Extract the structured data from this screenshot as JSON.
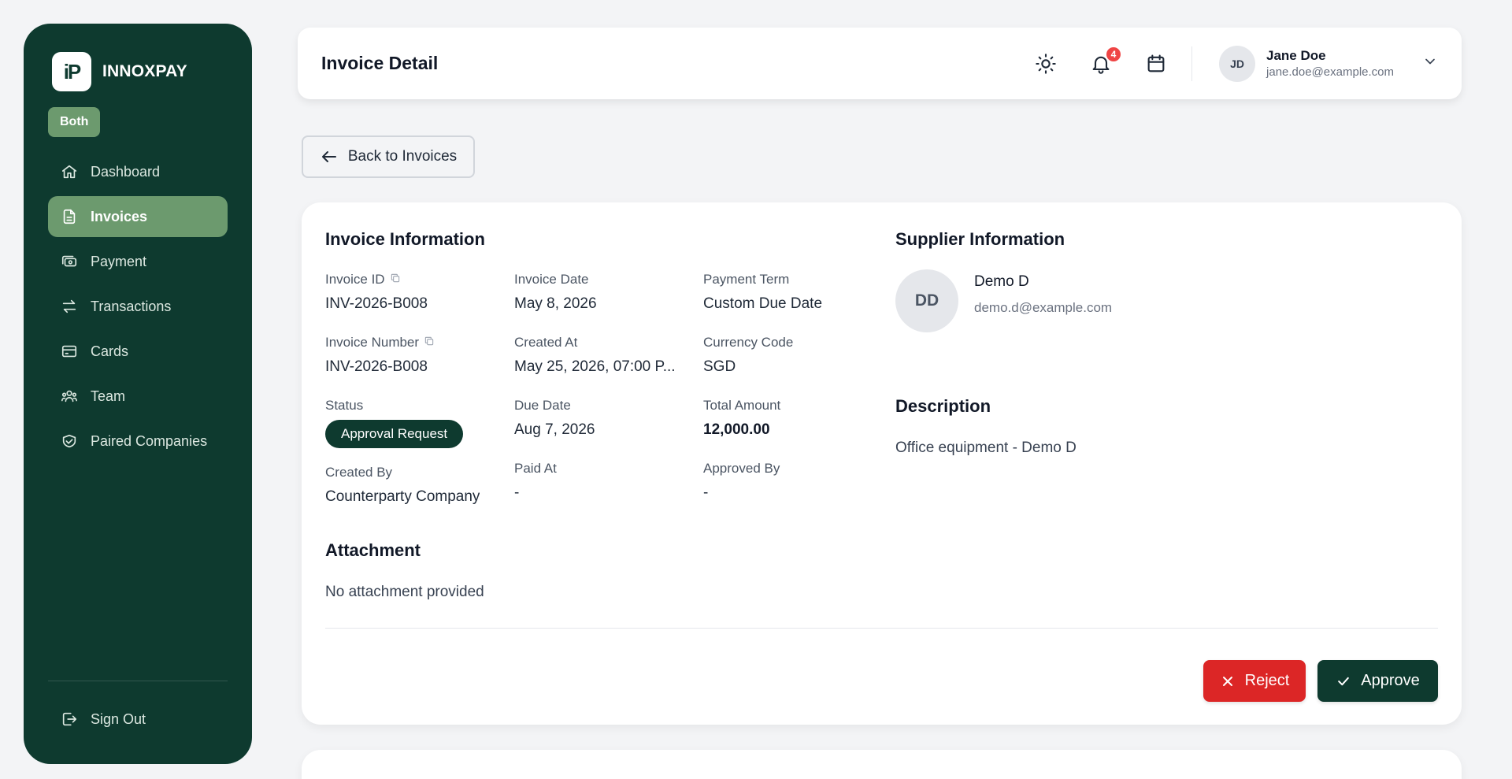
{
  "brand": {
    "logo_text": "iP",
    "name": "INNOXPAY",
    "mode": "Both"
  },
  "sidebar": {
    "items": [
      {
        "label": "Dashboard",
        "icon": "home-icon"
      },
      {
        "label": "Invoices",
        "icon": "file-text-icon",
        "active": true
      },
      {
        "label": "Payment",
        "icon": "cash-icon"
      },
      {
        "label": "Transactions",
        "icon": "arrows-exchange-icon"
      },
      {
        "label": "Cards",
        "icon": "credit-card-icon"
      },
      {
        "label": "Team",
        "icon": "users-icon"
      },
      {
        "label": "Paired Companies",
        "icon": "handshake-icon"
      }
    ],
    "sign_out": "Sign Out"
  },
  "header": {
    "title": "Invoice Detail",
    "notification_count": "4",
    "user": {
      "initials": "JD",
      "name": "Jane Doe",
      "email": "jane.doe@example.com"
    }
  },
  "back_button": "Back to Invoices",
  "invoice": {
    "section_title": "Invoice Information",
    "fields": {
      "invoice_id": {
        "label": "Invoice ID",
        "value": "INV-2026-B008"
      },
      "invoice_date": {
        "label": "Invoice Date",
        "value": "May 8, 2026"
      },
      "payment_term": {
        "label": "Payment Term",
        "value": "Custom Due Date"
      },
      "invoice_number": {
        "label": "Invoice Number",
        "value": "INV-2026-B008"
      },
      "created_at": {
        "label": "Created At",
        "value": "May 25, 2026, 07:00 P..."
      },
      "currency_code": {
        "label": "Currency Code",
        "value": "SGD"
      },
      "status": {
        "label": "Status",
        "value": "Approval Request"
      },
      "due_date": {
        "label": "Due Date",
        "value": "Aug 7, 2026"
      },
      "total_amount": {
        "label": "Total Amount",
        "value": "12,000.00"
      },
      "created_by": {
        "label": "Created By",
        "value": "Counterparty Company"
      },
      "paid_at": {
        "label": "Paid At",
        "value": "-"
      },
      "approved_by": {
        "label": "Approved By",
        "value": "-"
      }
    }
  },
  "attachment": {
    "title": "Attachment",
    "text": "No attachment provided"
  },
  "supplier": {
    "title": "Supplier Information",
    "initials": "DD",
    "name": "Demo D",
    "email": "demo.d@example.com"
  },
  "description": {
    "title": "Description",
    "text": "Office equipment - Demo D"
  },
  "actions": {
    "reject": "Reject",
    "approve": "Approve"
  },
  "colors": {
    "sidebar_bg": "#0e3a2f",
    "accent": "#6c9a6e",
    "reject": "#dc2626",
    "badge": "#ef4444"
  }
}
